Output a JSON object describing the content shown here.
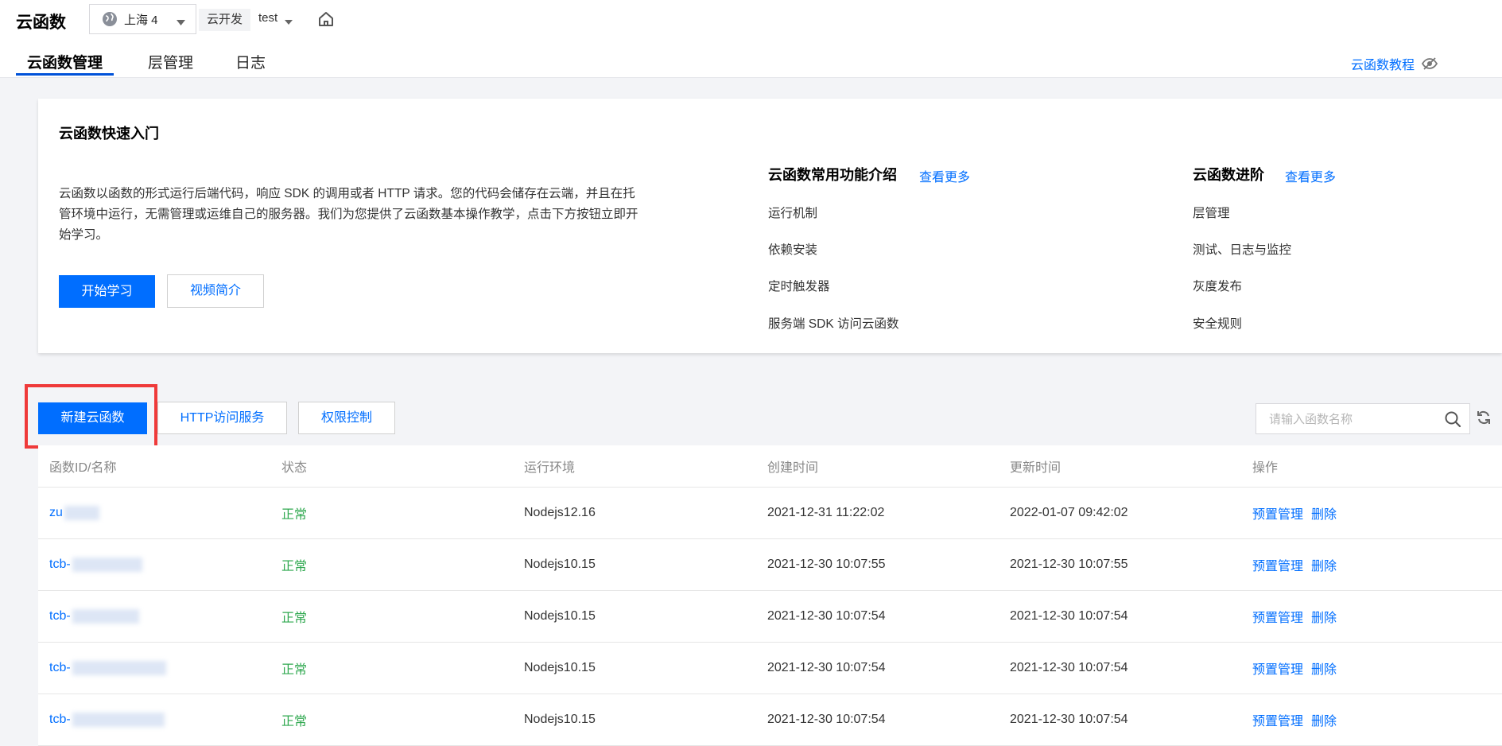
{
  "header": {
    "app_title": "云函数",
    "region": "上海 4",
    "env_tag": "云开发",
    "env_name": "test",
    "tutorial_link": "云函数教程"
  },
  "tabs": [
    {
      "label": "云函数管理",
      "active": true
    },
    {
      "label": "层管理",
      "active": false
    },
    {
      "label": "日志",
      "active": false
    }
  ],
  "intro": {
    "title": "云函数快速入门",
    "description": "云函数以函数的形式运行后端代码，响应 SDK 的调用或者 HTTP 请求。您的代码会储存在云端，并且在托管环境中运行，无需管理或运维自己的服务器。我们为您提供了云函数基本操作教学，点击下方按钮立即开始学习。",
    "start_button": "开始学习",
    "video_button": "视频简介",
    "features": {
      "title": "云函数常用功能介绍",
      "more": "查看更多",
      "items": [
        "运行机制",
        "依赖安装",
        "定时触发器",
        "服务端 SDK 访问云函数"
      ]
    },
    "advanced": {
      "title": "云函数进阶",
      "more": "查看更多",
      "items": [
        "层管理",
        "测试、日志与监控",
        "灰度发布",
        "安全规则"
      ]
    }
  },
  "toolbar": {
    "new_button": "新建云函数",
    "http_button": "HTTP访问服务",
    "perm_button": "权限控制",
    "search_placeholder": "请输入函数名称"
  },
  "table": {
    "columns": [
      "函数ID/名称",
      "状态",
      "运行环境",
      "创建时间",
      "更新时间",
      "操作"
    ],
    "rows": [
      {
        "name": "zu",
        "status": "正常",
        "runtime": "Nodejs12.16",
        "created": "2021-12-31 11:22:02",
        "updated": "2022-01-07 09:42:02"
      },
      {
        "name": "tcb-",
        "status": "正常",
        "runtime": "Nodejs10.15",
        "created": "2021-12-30 10:07:55",
        "updated": "2021-12-30 10:07:55"
      },
      {
        "name": "tcb-",
        "status": "正常",
        "runtime": "Nodejs10.15",
        "created": "2021-12-30 10:07:54",
        "updated": "2021-12-30 10:07:54"
      },
      {
        "name": "tcb-",
        "status": "正常",
        "runtime": "Nodejs10.15",
        "created": "2021-12-30 10:07:54",
        "updated": "2021-12-30 10:07:54"
      },
      {
        "name": "tcb-",
        "status": "正常",
        "runtime": "Nodejs10.15",
        "created": "2021-12-30 10:07:54",
        "updated": "2021-12-30 10:07:54"
      }
    ],
    "op_manage": "预置管理",
    "op_delete": "删除"
  },
  "colors": {
    "accent": "#006eff",
    "status_ok": "#2fa84f",
    "highlight": "#ef3a3a"
  }
}
